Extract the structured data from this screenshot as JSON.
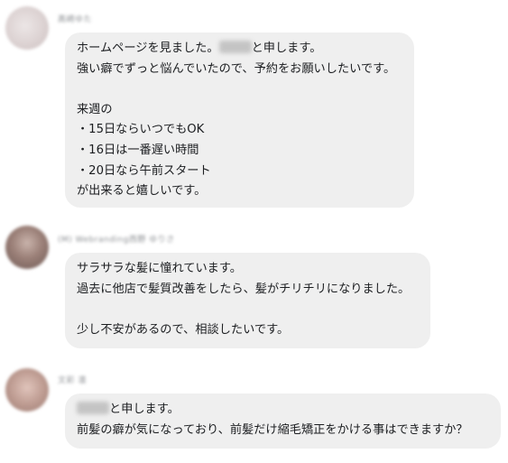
{
  "colors": {
    "bubble_bg": "#efefef",
    "text": "#1c1e21",
    "name_text": "#8a8d91",
    "page_bg": "#ffffff"
  },
  "messages": [
    {
      "sender_name": "髙崎ゆた",
      "redacted_name": "",
      "text_1_after_redaction": "と申します。",
      "text_1_before_redaction": "ホームページを見ました。",
      "line_2": "強い癖でずっと悩んでいたので、予約をお願いしたいです。",
      "line_4": "来週の",
      "line_5": "・15日ならいつでもOK",
      "line_6": "・16日は一番遅い時間",
      "line_7": "・20日なら午前スタート",
      "line_8": "が出来ると嬉しいです。"
    },
    {
      "sender_name": "(M) Webranding西野 ゆりさ",
      "line_1": "サラサラな髪に憧れています。",
      "line_2": "過去に他店で髪質改善をしたら、髪がチリチリになりました。",
      "line_4": "少し不安があるので、相談したいです。"
    },
    {
      "sender_name": "文彩 凛",
      "text_1_after_redaction": "と申します。",
      "line_2": "前髪の癖が気になっており、前髪だけ縮毛矯正をかける事はできますか？"
    }
  ]
}
